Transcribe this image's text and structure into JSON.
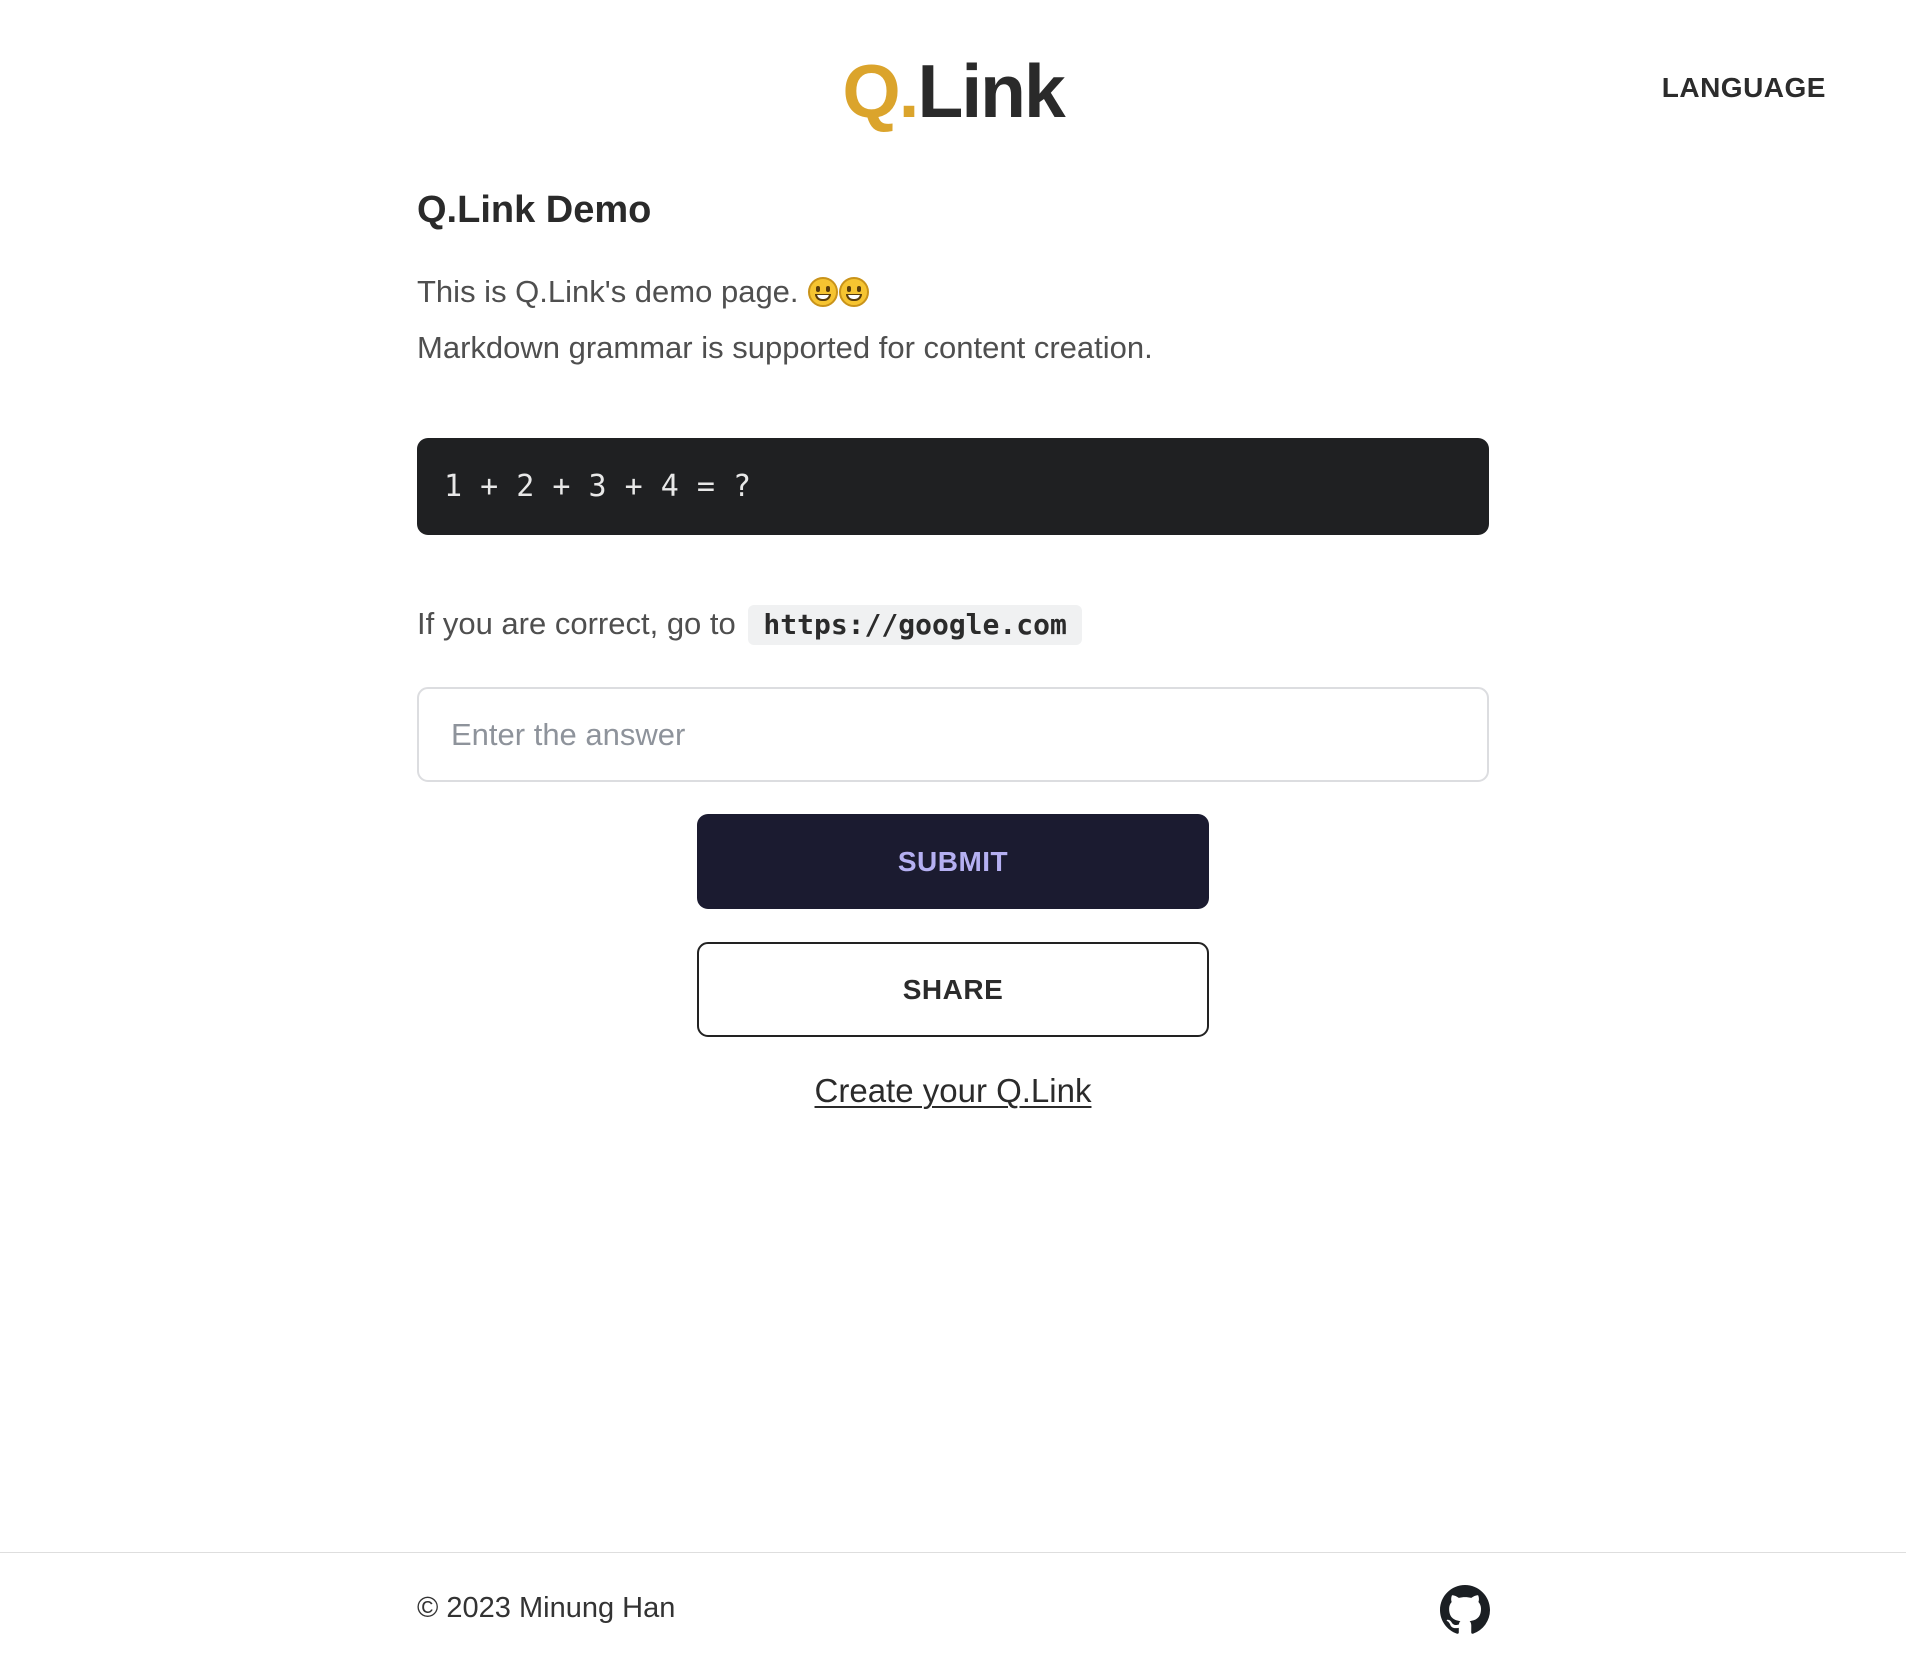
{
  "header": {
    "logo_q": "Q.",
    "logo_rest": "Link",
    "language_label": "LANGUAGE"
  },
  "demo": {
    "title": "Q.Link Demo",
    "description_line1": "This is Q.Link's demo page.",
    "emojis": [
      "grinning-face-emoji",
      "grinning-face-emoji"
    ],
    "description_line2": "Markdown grammar is supported for content creation.",
    "code": "1 + 2 + 3 + 4 = ?",
    "hint_text": "If you are correct, go to",
    "hint_code": "https://google.com"
  },
  "form": {
    "answer_placeholder": "Enter the answer",
    "answer_value": "",
    "submit_label": "SUBMIT",
    "share_label": "SHARE",
    "create_link_label": "Create your Q.Link"
  },
  "footer": {
    "copyright": "© 2023 Minung Han",
    "github_icon": "github-icon"
  },
  "colors": {
    "brand_accent": "#dba42c",
    "submit_bg": "#1b1b30",
    "submit_text": "#b5b0f2",
    "code_bg": "#1f2022"
  }
}
